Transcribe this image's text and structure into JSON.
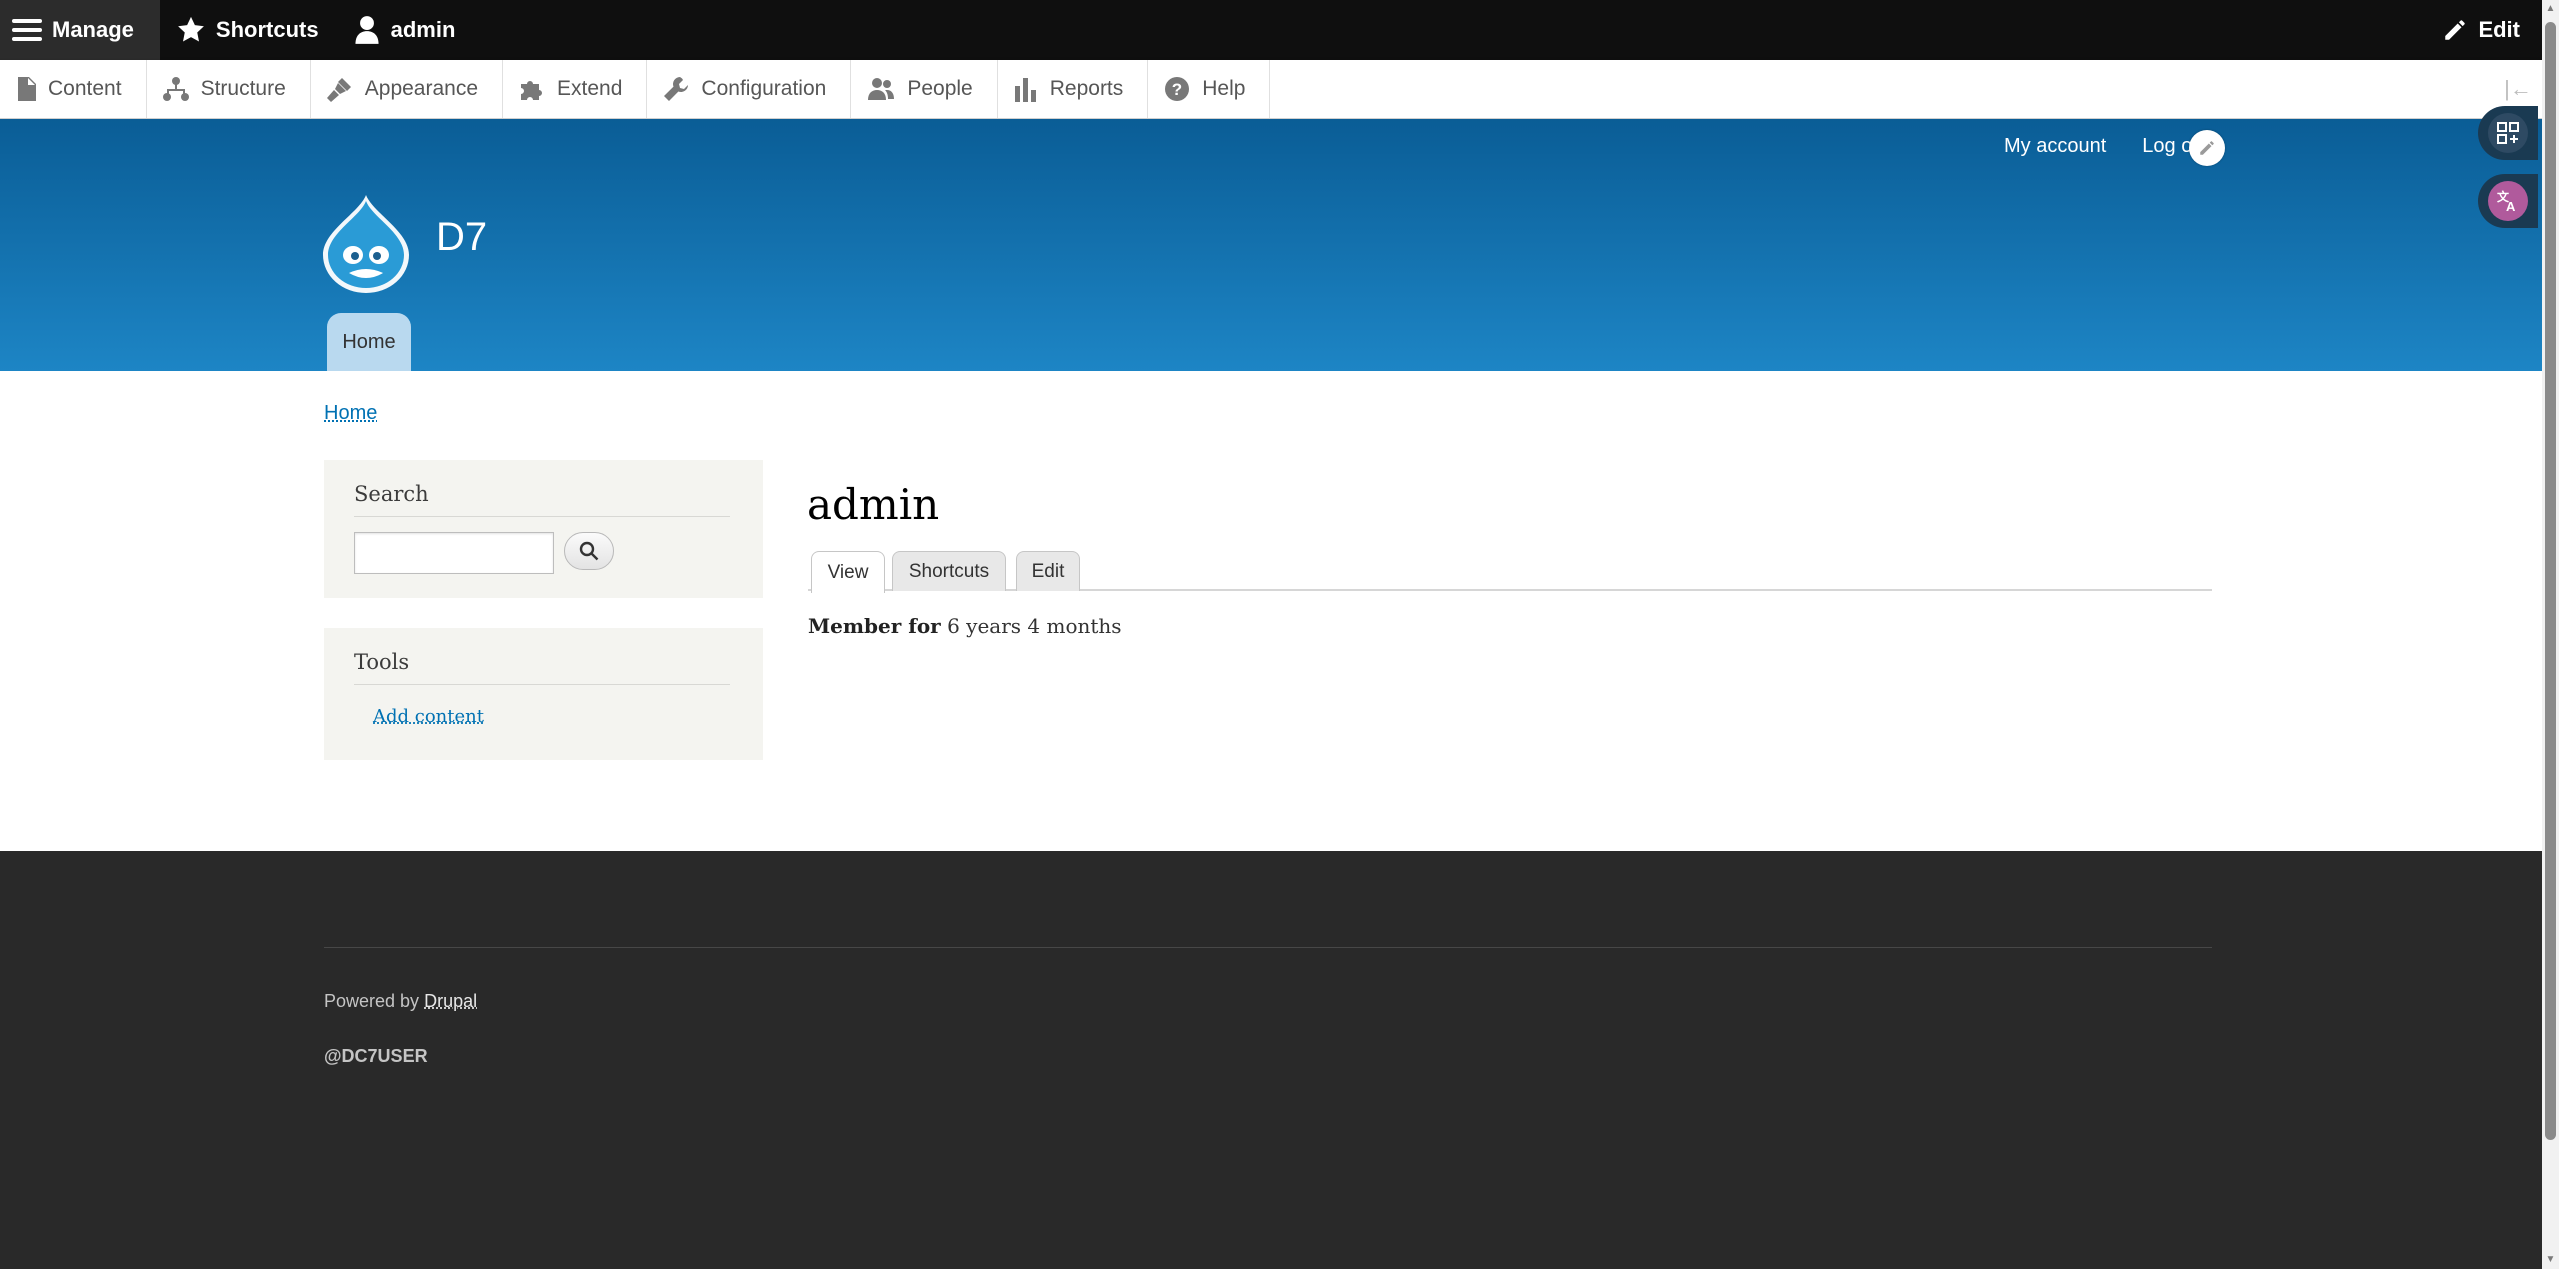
{
  "toolbar": {
    "manage_label": "Manage",
    "shortcuts_label": "Shortcuts",
    "user_label": "admin",
    "edit_label": "Edit"
  },
  "tray": {
    "items": [
      {
        "label": "Content",
        "icon": "file-icon"
      },
      {
        "label": "Structure",
        "icon": "sitemap-icon"
      },
      {
        "label": "Appearance",
        "icon": "paintbrush-icon"
      },
      {
        "label": "Extend",
        "icon": "puzzle-icon"
      },
      {
        "label": "Configuration",
        "icon": "wrench-icon"
      },
      {
        "label": "People",
        "icon": "people-icon"
      },
      {
        "label": "Reports",
        "icon": "bar-chart-icon"
      },
      {
        "label": "Help",
        "icon": "question-icon"
      }
    ]
  },
  "header": {
    "secondary_menu": [
      "My account",
      "Log out"
    ],
    "site_name": "D7",
    "primary_tab": "Home"
  },
  "breadcrumb": "Home",
  "sidebar": {
    "search_title": "Search",
    "search_placeholder": "",
    "tools_title": "Tools",
    "tools_link": "Add content"
  },
  "main": {
    "page_title": "admin",
    "tabs": [
      "View",
      "Shortcuts",
      "Edit"
    ],
    "member_label": "Member for",
    "member_value": "6 years 4 months"
  },
  "footer": {
    "powered_prefix": "Powered by",
    "powered_link": "Drupal",
    "handle": "@DC7USER"
  },
  "colors": {
    "toolbar_bg": "#0f0f0f",
    "header_top": "#0a5d96",
    "header_bottom": "#1d85c5",
    "link": "#0071b3",
    "footer_bg": "#292929"
  }
}
